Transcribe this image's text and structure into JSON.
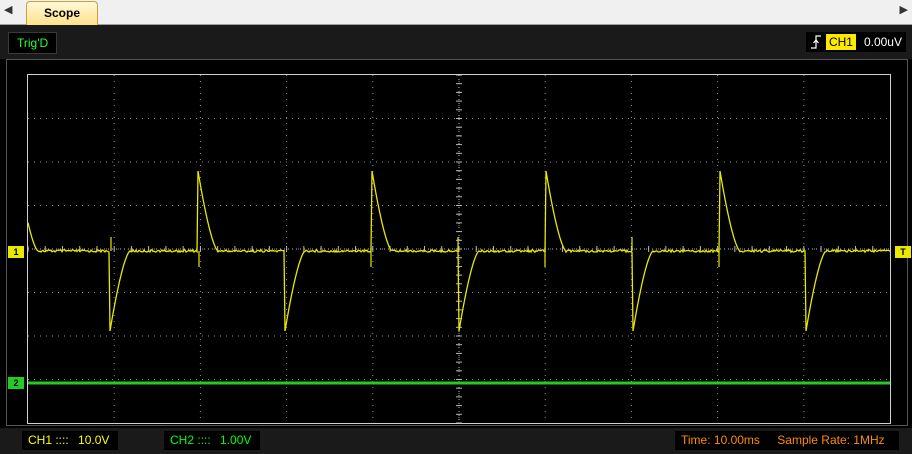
{
  "tabs": {
    "left_arrow": "◀",
    "active": "Scope",
    "right_arrow": "▶"
  },
  "trigger": {
    "status": "Trig'D",
    "channel": "CH1",
    "level": "0.00uV"
  },
  "markers": {
    "ch1": "1",
    "ch2": "2",
    "trig": "T"
  },
  "channels": [
    {
      "label": "CH1 ::::",
      "value": "10.0V",
      "color": "#ffff00"
    },
    {
      "label": "CH2 ::::",
      "value": "1.00V",
      "color": "#00ff00"
    }
  ],
  "status": {
    "time": "Time: 10.00ms",
    "sample_rate": "Sample Rate: 1MHz"
  },
  "colors": {
    "ch1": "#e8e800",
    "ch2": "#22cc22",
    "status": "#ff8c00",
    "grid": "#bbbbbb"
  },
  "icons": {
    "trigger_edge": "rising-edge-icon"
  }
}
